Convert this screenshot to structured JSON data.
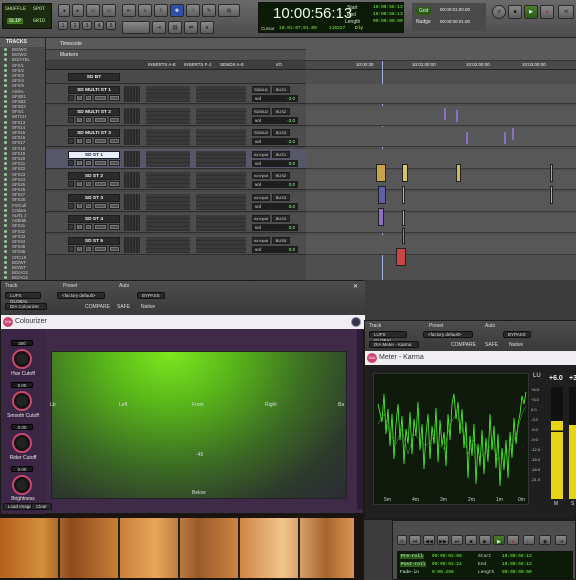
{
  "toolbar": {
    "mode_buttons": [
      "SHUFFLE",
      "SPOT",
      "SLIP",
      "GRID"
    ],
    "main_counter": "10:00:56:13",
    "start_label": "Start",
    "end_label": "End",
    "length_label": "Length",
    "start_value": "10:00:56:13",
    "end_value": "10:00:56:13",
    "length_value": "00:00:00:00",
    "cursor_label": "Cursor",
    "cursor_value": "10:01:07:01.00",
    "sample_value": "110227",
    "grid_label": "Grid",
    "grid_value": "00:00:01:00.00",
    "nudge_label": "Nudge",
    "nudge_value": "00:00:00:01.00",
    "track_numbers": [
      "1",
      "2",
      "3",
      "4",
      "5"
    ]
  },
  "tracks_panel": {
    "header": "TRACKS",
    "items": [
      "BG/WG",
      "BG/WG",
      "BG/ATEL",
      "SFX/1",
      "SFX/2",
      "SFX/3",
      "SFX/4",
      "SFX/5",
      "AmbA",
      "SFXB1",
      "SFXB2",
      "SFXB3",
      "SFX/1",
      "WITCH",
      "SFX13",
      "SFX14",
      "SFX15",
      "SFX16",
      "SFX17",
      "SFX18",
      "SFX19",
      "SFX20",
      "SFX21",
      "SFX22",
      "SFX23",
      "SFX24",
      "SFX25",
      "SFX26",
      "SFX27",
      "SFX28",
      "FX/Coll",
      "Crtdam",
      "ALR1 1",
      "ASB/ak",
      "SFX31",
      "SFX32",
      "SFX33",
      "SFX34",
      "SFX35",
      "SFX36",
      "CRC19",
      "BG/WT",
      "BG/WT",
      "BG/AG1",
      "BG/AG2",
      "BG/AG3",
      "BG/G1",
      "BG/01",
      "BG/02",
      "AUX1",
      "AUX1"
    ]
  },
  "mix_panel": {
    "timecode_label": "Timecode",
    "markers_label": "Markers",
    "inserts_ae_label": "INSERTS A-E",
    "inserts_fj_label": "INSERTS F-J",
    "sends_label": "SENDS A-E",
    "io_label": "I/O",
    "tracks": [
      {
        "name": "SD BT",
        "output": "",
        "volume": "",
        "sub": "overview"
      },
      {
        "name": "SD MULTI ST 1",
        "output": "BUS1",
        "input": "SDMU1",
        "volume": "-2.0"
      },
      {
        "name": "SD MULTI ST 2",
        "output": "BUS2",
        "input": "SDMU2",
        "volume": "-2.0"
      },
      {
        "name": "SD MULTI ST 3",
        "output": "BUS3",
        "input": "SDMU3",
        "volume": "-2.0"
      },
      {
        "name": "SD ST 1",
        "output": "BUS1",
        "input": "no input",
        "volume": "0.0"
      },
      {
        "name": "SD ST 2",
        "output": "BUS2",
        "input": "no input",
        "volume": "0.0"
      },
      {
        "name": "SD ST 3",
        "output": "BUS3",
        "input": "no input",
        "volume": "0.0"
      },
      {
        "name": "SD ST 4",
        "output": "BUS4",
        "input": "no input",
        "volume": "0.0"
      },
      {
        "name": "SD ST 5",
        "output": "BUS5",
        "input": "no input",
        "volume": "0.0"
      }
    ],
    "vol_label": "vol",
    "wave_label": "wave",
    "read_label": "read"
  },
  "timeline": {
    "ruler": [
      "00:00:00:00",
      "10:00:30",
      "10:01:00:00",
      "10:02:00:00",
      "10:03:00:00",
      "10:04:00:00"
    ]
  },
  "colourizer": {
    "track_label": "Track",
    "preset_label": "Preset",
    "auto_label": "Auto",
    "track_value": "LUFS GLOBAL",
    "preset_value": "<factory default>",
    "plugin_select": "DIA Colourizer",
    "compare_label": "COMPARE",
    "bypass_label": "BYPASS",
    "safe_label": "SAFE",
    "native_label": "Native",
    "title": "Colourizer",
    "knobs": [
      {
        "value": "300",
        "label": "Hue Cutoff"
      },
      {
        "value": "0.00",
        "label": "Smooth Cutoff"
      },
      {
        "value": "0.00",
        "label": "Rider Cutoff"
      },
      {
        "value": "0.00",
        "label": "Brightness"
      }
    ],
    "axis_left": "Left",
    "axis_front": "Front",
    "axis_right": "Right",
    "axis_back": "Back",
    "axis_below": "Below",
    "axis_neg45": "-45",
    "edge_left": "Lb",
    "edge_right": "Ba",
    "load_image_label": "Load Image",
    "clear_label": "Clear"
  },
  "meter_plugin": {
    "track_label": "Track",
    "preset_label": "Preset",
    "auto_label": "Auto",
    "track_value": "LUFS GLOBAL",
    "preset_value": "<factory default>",
    "plugin_select": "DIA Meter - Karma",
    "compare_label": "COMPARE",
    "bypass_label": "BYPASS",
    "safe_label": "SAFE",
    "native_label": "Native",
    "title": "Meter - Karma",
    "lu_label": "LU",
    "plus6_label": "+6.0",
    "plus3_label": "+3",
    "time_ticks": [
      "5m",
      "4m",
      "3m",
      "2m",
      "1m",
      "0m"
    ],
    "lu_ticks": [
      "+6.0",
      "+3.0",
      "0.0",
      "-3.0",
      "-6.0",
      "-9.0",
      "-12.0",
      "-15.0",
      "-18.0",
      "-21.0"
    ],
    "m_label": "M",
    "s_label": "S"
  },
  "transport": {
    "preroll_label": "Pre-roll",
    "postroll_label": "Post-roll",
    "fadein_label": "Fade-in",
    "preroll_value": "00:00:02:00",
    "postroll_value": "00:00:02:24",
    "fadein_value": "0:00.250",
    "start_label": "Start",
    "end_label": "End",
    "length_label": "Length",
    "start_value": "10:00:56:13",
    "end_value": "10:00:56:13",
    "length_value": "00:00:00:00"
  },
  "colors": {
    "accent_pink": "#c8466f",
    "meter_green": "#4cff2c",
    "meter_yellow": "#e6d41b",
    "lcd_green": "#7dff3a"
  }
}
